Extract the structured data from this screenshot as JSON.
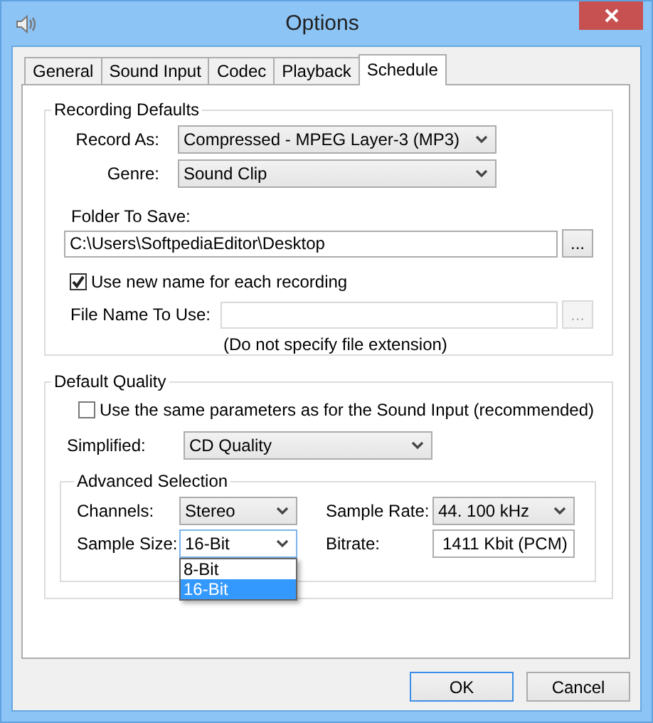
{
  "window": {
    "title": "Options"
  },
  "tabs": [
    {
      "label": "General",
      "selected": false
    },
    {
      "label": "Sound Input",
      "selected": false
    },
    {
      "label": "Codec",
      "selected": false
    },
    {
      "label": "Playback",
      "selected": false
    },
    {
      "label": "Schedule",
      "selected": true
    }
  ],
  "recording_defaults": {
    "title": "Recording Defaults",
    "record_as": {
      "label": "Record As:",
      "value": "Compressed - MPEG Layer-3 (MP3)"
    },
    "genre": {
      "label": "Genre:",
      "value": "Sound Clip"
    },
    "folder": {
      "label": "Folder To Save:",
      "value": "C:\\Users\\SoftpediaEditor\\Desktop",
      "browse_label": "...",
      "disabled": false
    },
    "use_new_name": {
      "label": "Use new name for each recording",
      "checked": true
    },
    "file_name": {
      "label": "File Name To Use:",
      "browse_label": "...",
      "disabled": true
    },
    "hint": "(Do not specify file extension)"
  },
  "default_quality": {
    "title": "Default Quality",
    "same_params": {
      "label": "Use the same parameters as for the Sound Input (recommended)",
      "checked": false
    },
    "simplified": {
      "label": "Simplified:",
      "value": "CD Quality"
    },
    "advanced": {
      "title": "Advanced Selection",
      "channels": {
        "label": "Channels:",
        "value": "Stereo"
      },
      "sample_rate": {
        "label": "Sample Rate:",
        "value": "44. 100 kHz"
      },
      "sample_size": {
        "label": "Sample Size:",
        "value": "16-Bit",
        "expanded": true,
        "options": [
          {
            "label": "8-Bit",
            "selected": false
          },
          {
            "label": "16-Bit",
            "selected": true
          }
        ]
      },
      "bitrate": {
        "label": "Bitrate:",
        "value": "1411 Kbit (PCM)"
      }
    }
  },
  "buttons": [
    {
      "label": "OK",
      "default": true
    },
    {
      "label": "Cancel",
      "default": false
    }
  ]
}
